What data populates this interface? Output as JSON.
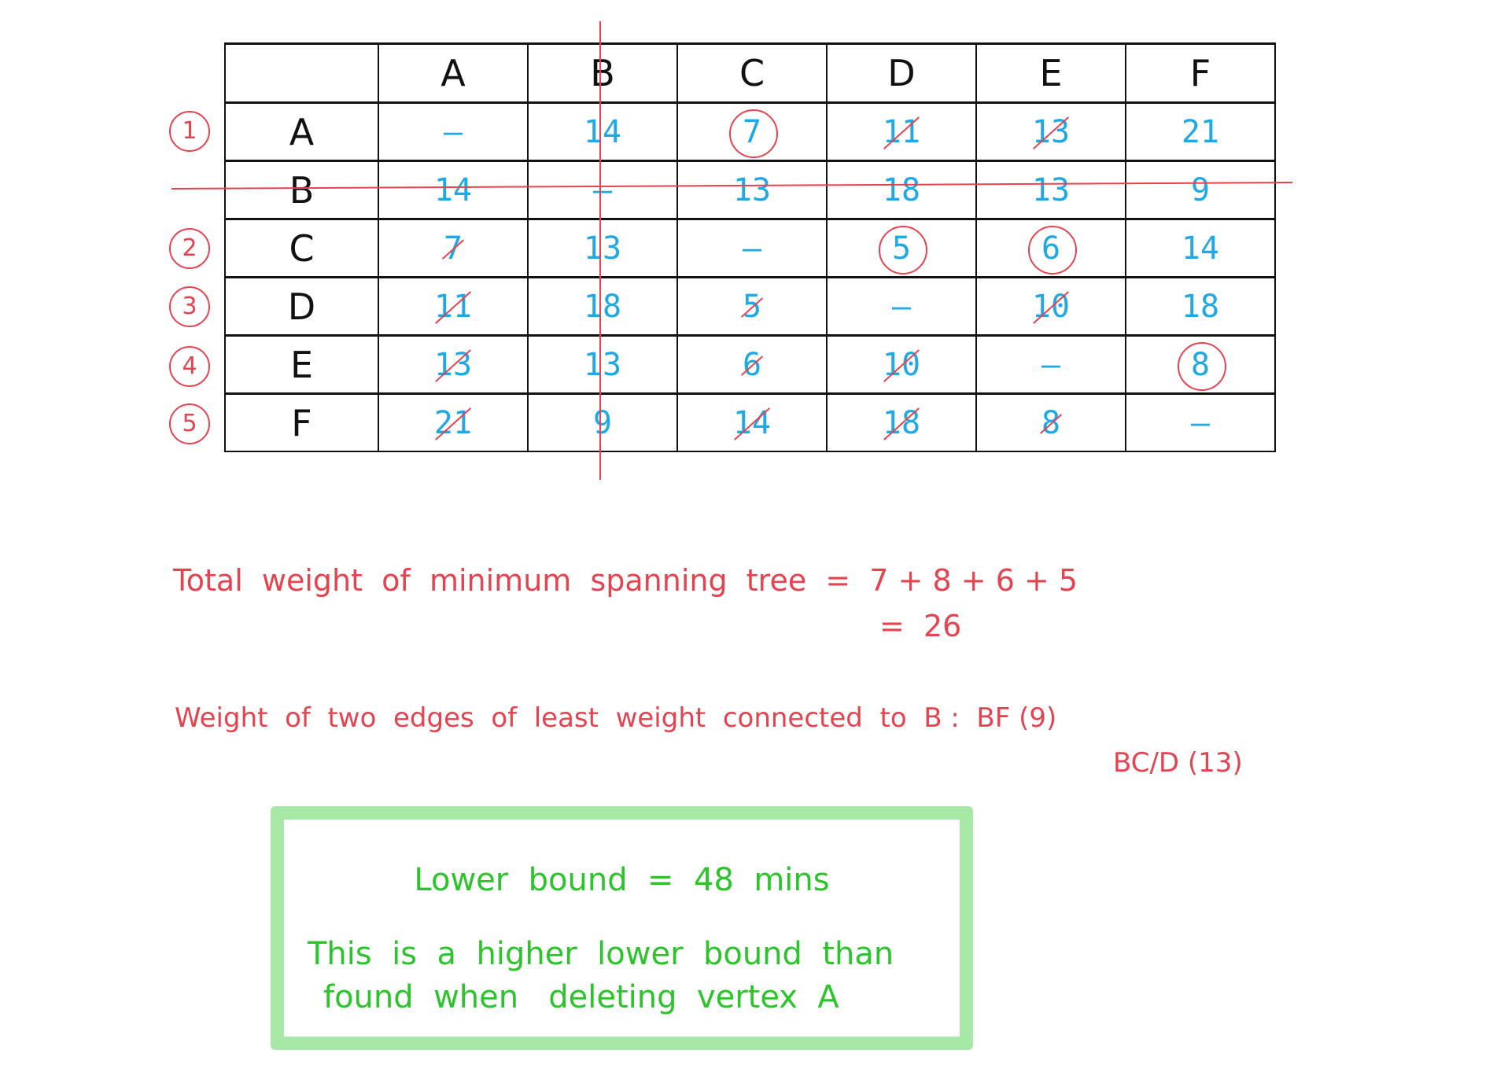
{
  "table": {
    "column_headers": [
      "A",
      "B",
      "C",
      "D",
      "E",
      "F"
    ],
    "rows": [
      {
        "label": "A",
        "step": "1",
        "cells": [
          {
            "v": "—",
            "mark": "none"
          },
          {
            "v": "14",
            "mark": "none"
          },
          {
            "v": "7",
            "mark": "circled"
          },
          {
            "v": "11",
            "mark": "crossed"
          },
          {
            "v": "13",
            "mark": "crossed"
          },
          {
            "v": "21",
            "mark": "none"
          }
        ]
      },
      {
        "label": "B",
        "step": "",
        "cells": [
          {
            "v": "14",
            "mark": "none"
          },
          {
            "v": "—",
            "mark": "none"
          },
          {
            "v": "13",
            "mark": "none"
          },
          {
            "v": "18",
            "mark": "none"
          },
          {
            "v": "13",
            "mark": "none"
          },
          {
            "v": "9",
            "mark": "none"
          }
        ]
      },
      {
        "label": "C",
        "step": "2",
        "cells": [
          {
            "v": "7",
            "mark": "crossed"
          },
          {
            "v": "13",
            "mark": "none"
          },
          {
            "v": "—",
            "mark": "none"
          },
          {
            "v": "5",
            "mark": "circled"
          },
          {
            "v": "6",
            "mark": "circled"
          },
          {
            "v": "14",
            "mark": "none"
          }
        ]
      },
      {
        "label": "D",
        "step": "3",
        "cells": [
          {
            "v": "11",
            "mark": "crossed"
          },
          {
            "v": "18",
            "mark": "none"
          },
          {
            "v": "5",
            "mark": "crossed"
          },
          {
            "v": "—",
            "mark": "none"
          },
          {
            "v": "10",
            "mark": "crossed"
          },
          {
            "v": "18",
            "mark": "none"
          }
        ]
      },
      {
        "label": "E",
        "step": "4",
        "cells": [
          {
            "v": "13",
            "mark": "crossed"
          },
          {
            "v": "13",
            "mark": "none"
          },
          {
            "v": "6",
            "mark": "crossed"
          },
          {
            "v": "10",
            "mark": "crossed"
          },
          {
            "v": "—",
            "mark": "none"
          },
          {
            "v": "8",
            "mark": "circled"
          }
        ]
      },
      {
        "label": "F",
        "step": "5",
        "cells": [
          {
            "v": "21",
            "mark": "crossed"
          },
          {
            "v": "9",
            "mark": "none"
          },
          {
            "v": "14",
            "mark": "crossed"
          },
          {
            "v": "18",
            "mark": "crossed"
          },
          {
            "v": "8",
            "mark": "crossed"
          },
          {
            "v": "—",
            "mark": "none"
          }
        ]
      }
    ],
    "deleted_vertex": "B"
  },
  "working": {
    "mst_line1": "Total  weight  of  minimum  spanning  tree  =  7 + 8 + 6 + 5",
    "mst_line2": "=  26",
    "edges_line1": "Weight  of  two  edges  of  least  weight  connected  to  B :  BF (9)",
    "edges_line2": "BC/D (13)"
  },
  "conclusion": {
    "line1": "Lower  bound  =  48  mins",
    "line2": "This  is  a  higher  lower  bound  than",
    "line3": "found  when   deleting  vertex  A"
  },
  "colors": {
    "ink_blue": "#1fa8e6",
    "ink_red": "#e5434f",
    "ink_green": "#2bc42b",
    "box_border": "#a8e8a6"
  }
}
